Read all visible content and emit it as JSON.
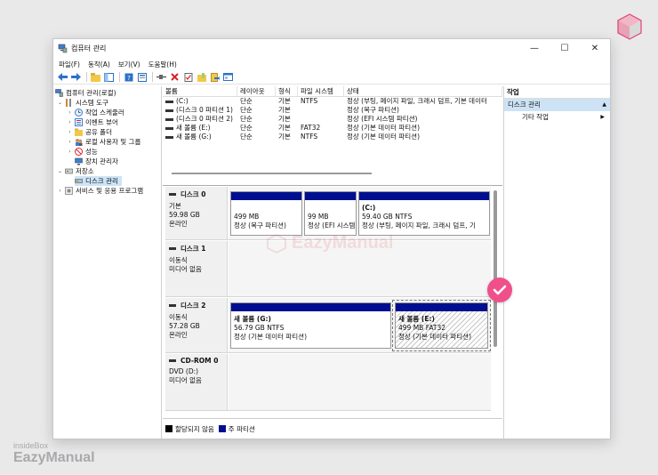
{
  "window": {
    "title": "컴퓨터 관리"
  },
  "menu": [
    "파일(F)",
    "동작(A)",
    "보기(V)",
    "도움말(H)"
  ],
  "tree": [
    {
      "label": "컴퓨터 관리(로컬)",
      "icon": "computer-management-icon"
    },
    {
      "label": "시스템 도구",
      "icon": "tools-icon"
    },
    {
      "label": "작업 스케줄러",
      "icon": "clock-icon"
    },
    {
      "label": "이벤트 뷰어",
      "icon": "event-viewer-icon"
    },
    {
      "label": "공유 폴더",
      "icon": "folder-icon"
    },
    {
      "label": "로컬 사용자 및 그룹",
      "icon": "users-icon"
    },
    {
      "label": "성능",
      "icon": "performance-icon"
    },
    {
      "label": "장치 관리자",
      "icon": "device-manager-icon"
    },
    {
      "label": "저장소",
      "icon": "storage-icon"
    },
    {
      "label": "디스크 관리",
      "icon": "disk-icon"
    },
    {
      "label": "서비스 및 응용 프로그램",
      "icon": "services-icon"
    }
  ],
  "volume_table": {
    "headers": [
      "볼륨",
      "레이아웃",
      "형식",
      "파일 시스템",
      "상태"
    ],
    "rows": [
      {
        "volume": "(C:)",
        "layout": "단순",
        "type": "기본",
        "fs": "NTFS",
        "status": "정상 (부팅, 페이지 파일, 크래시 덤프, 기본 데이터"
      },
      {
        "volume": "(디스크 0 파티션 1)",
        "layout": "단순",
        "type": "기본",
        "fs": "",
        "status": "정상 (복구 파티션)"
      },
      {
        "volume": "(디스크 0 파티션 2)",
        "layout": "단순",
        "type": "기본",
        "fs": "",
        "status": "정상 (EFI 시스템 파티션)"
      },
      {
        "volume": "새 볼륨 (E:)",
        "layout": "단순",
        "type": "기본",
        "fs": "FAT32",
        "status": "정상 (기본 데이터 파티션)"
      },
      {
        "volume": "새 볼륨 (G:)",
        "layout": "단순",
        "type": "기본",
        "fs": "NTFS",
        "status": "정상 (기본 데이터 파티션)"
      }
    ]
  },
  "disks": [
    {
      "name": "디스크 0",
      "lines": [
        "기본",
        "59.98 GB",
        "온라인"
      ],
      "partitions": [
        {
          "title": "",
          "size": "499 MB",
          "status": "정상 (복구 파티션)"
        },
        {
          "title": "",
          "size": "99 MB",
          "status": "정상 (EFI 시스템"
        },
        {
          "title": "(C:)",
          "size": "59.40 GB NTFS",
          "status": "정상 (부팅, 페이지 파일, 크래시 덤프, 기"
        }
      ]
    },
    {
      "name": "디스크 1",
      "lines": [
        "이동식",
        "",
        "미디어 없음"
      ],
      "partitions": []
    },
    {
      "name": "디스크 2",
      "lines": [
        "이동식",
        "57.28 GB",
        "온라인"
      ],
      "partitions": [
        {
          "title": "새 볼륨 (G:)",
          "size": "56.79 GB NTFS",
          "status": "정상 (기본 데이터 파티션)"
        },
        {
          "title": "새 볼륨 (E:)",
          "size": "499 MB FAT32",
          "status": "정상 (기본 데이터 파티션)"
        }
      ]
    },
    {
      "name": "CD-ROM 0",
      "lines": [
        "DVD (D:)",
        "",
        "미디어 없음"
      ],
      "partitions": []
    }
  ],
  "legend": {
    "unallocated": "할당되지 않음",
    "primary": "주 파티션"
  },
  "actions": {
    "header": "작업",
    "selected": "디스크 관리",
    "more": "기타 작업"
  },
  "branding": {
    "small": "insideBox",
    "big": "EazyManual",
    "watermark": "EazyManual"
  },
  "colors": {
    "partition_bar": "#000f8f",
    "accent_pink": "#f0508a",
    "selection": "#cce4f7"
  }
}
